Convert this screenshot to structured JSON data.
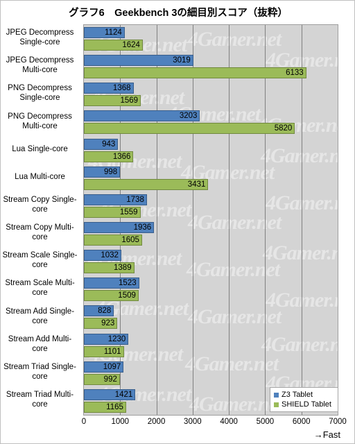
{
  "chart_data": {
    "type": "bar",
    "orientation": "horizontal",
    "title": "グラフ6　Geekbench 3の細目別スコア（抜粋）",
    "xlabel": "→Fast",
    "ylabel": "",
    "xlim": [
      0,
      7000
    ],
    "xticks": [
      0,
      1000,
      2000,
      3000,
      4000,
      5000,
      6000,
      7000
    ],
    "xtick_labels": [
      "0",
      "1000",
      "2000",
      "3000",
      "4000",
      "5000",
      "6000",
      "7000"
    ],
    "grid": true,
    "legend_position": "bottom-right",
    "categories": [
      "JPEG Decompress Single-core",
      "JPEG Decompress Multi-core",
      "PNG Decompress Single-core",
      "PNG Decompress Multi-core",
      "Lua Single-core",
      "Lua Multi-core",
      "Stream Copy Single-core",
      "Stream Copy Multi-core",
      "Stream Scale Single-core",
      "Stream Scale Multi-core",
      "Stream Add Single-core",
      "Stream Add Multi-core",
      "Stream Triad Single-core",
      "Stream Triad Multi-core"
    ],
    "category_lines": [
      [
        "JPEG Decompress",
        "Single-core"
      ],
      [
        "JPEG Decompress",
        "Multi-core"
      ],
      [
        "PNG Decompress",
        "Single-core"
      ],
      [
        "PNG Decompress",
        "Multi-core"
      ],
      [
        "Lua Single-core"
      ],
      [
        "Lua Multi-core"
      ],
      [
        "Stream Copy Single-",
        "core"
      ],
      [
        "Stream Copy Multi-",
        "core"
      ],
      [
        "Stream Scale Single-",
        "core"
      ],
      [
        "Stream Scale Multi-",
        "core"
      ],
      [
        "Stream Add Single-",
        "core"
      ],
      [
        "Stream Add Multi-",
        "core"
      ],
      [
        "Stream Triad Single-",
        "core"
      ],
      [
        "Stream Triad Multi-",
        "core"
      ]
    ],
    "series": [
      {
        "name": "Z3 Tablet",
        "color": "#4f81bd",
        "values": [
          1124,
          3019,
          1368,
          3203,
          943,
          998,
          1738,
          1936,
          1032,
          1523,
          828,
          1230,
          1097,
          1421
        ]
      },
      {
        "name": "SHIELD Tablet",
        "color": "#9bbb59",
        "values": [
          1624,
          6133,
          1569,
          5820,
          1366,
          3431,
          1559,
          1605,
          1389,
          1509,
          923,
          1101,
          992,
          1165
        ]
      }
    ]
  },
  "watermark": {
    "text": "4Gamer.net"
  },
  "colors": {
    "series1": "#4f81bd",
    "series2": "#9bbb59",
    "plot_background": "#d4d4d4",
    "gridline": "#808080"
  }
}
